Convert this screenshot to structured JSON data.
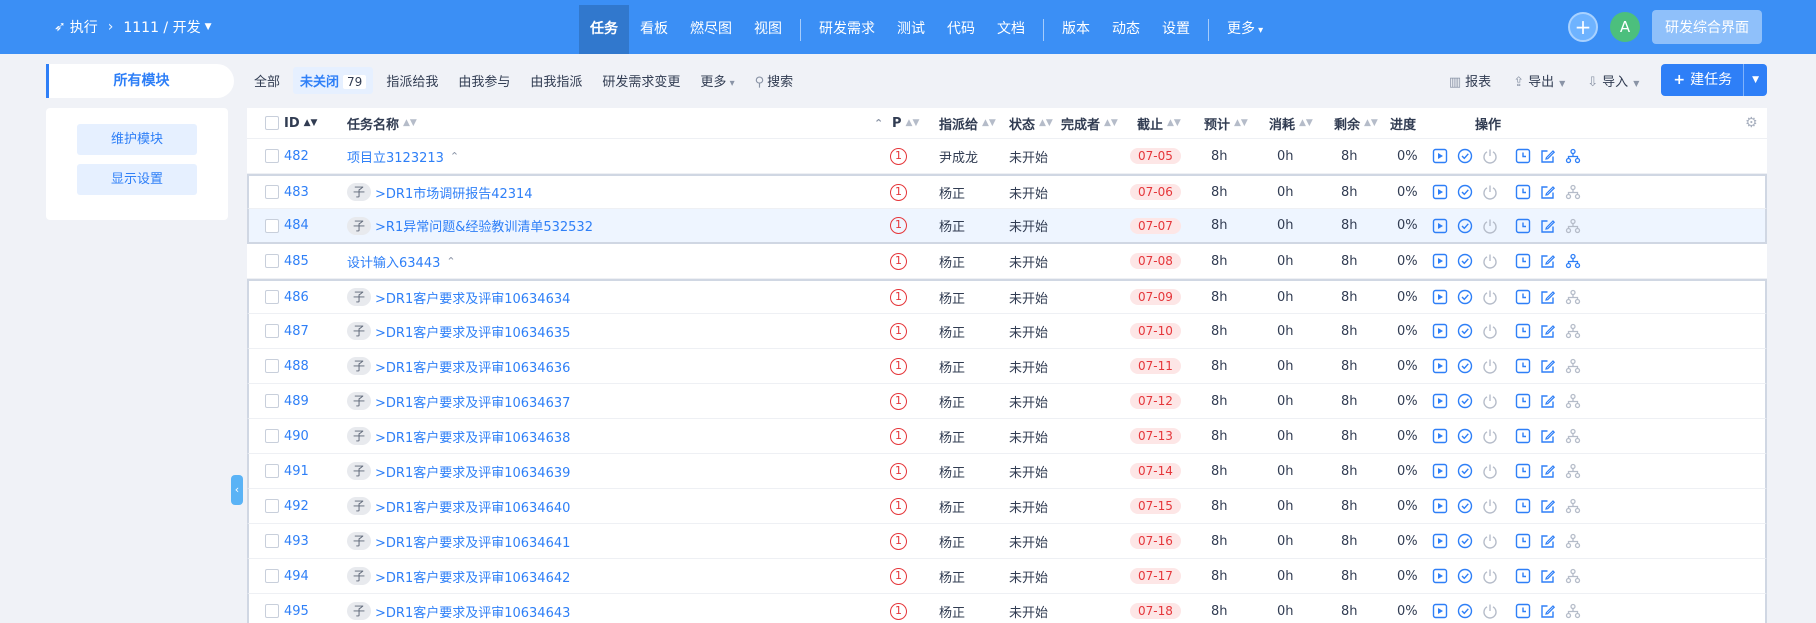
{
  "breadcrumb": {
    "app": "执行",
    "project": "1111 / 开发"
  },
  "nav": {
    "groups": [
      [
        "任务",
        "看板",
        "燃尽图",
        "视图"
      ],
      [
        "研发需求",
        "测试",
        "代码",
        "文档"
      ],
      [
        "版本",
        "动态",
        "设置"
      ],
      [
        "更多"
      ]
    ],
    "active": "任务"
  },
  "user": {
    "avatar": "A",
    "dev_button": "研发综合界面"
  },
  "sidebar": {
    "tab": "所有模块",
    "buttons": [
      "维护模块",
      "显示设置"
    ]
  },
  "toolbar": {
    "tabs": [
      {
        "label": "全部"
      },
      {
        "label": "未关闭",
        "count": "79",
        "active": true
      },
      {
        "label": "指派给我"
      },
      {
        "label": "由我参与"
      },
      {
        "label": "由我指派"
      },
      {
        "label": "研发需求变更"
      },
      {
        "label": "更多"
      }
    ],
    "search": "搜索",
    "report": "报表",
    "export": "导出",
    "import": "导入",
    "create": "建任务"
  },
  "table": {
    "headers": {
      "id": "ID",
      "name": "任务名称",
      "pri": "P",
      "assigned": "指派给",
      "status": "状态",
      "finisher": "完成者",
      "deadline": "截止",
      "estimate": "预计",
      "consumed": "消耗",
      "left": "剩余",
      "progress": "进度",
      "actions": "操作"
    },
    "rows": [
      {
        "id": "482",
        "name": "项目立3123213",
        "child": false,
        "pri": "1",
        "assigned": "尹成龙",
        "status": "未开始",
        "deadline": "07-05",
        "estimate": "8h",
        "consumed": "0h",
        "left": "8h",
        "progress": "0%"
      },
      {
        "id": "483",
        "name": ">DR1市场调研报告42314",
        "child": true,
        "pri": "1",
        "assigned": "杨正",
        "status": "未开始",
        "deadline": "07-06",
        "estimate": "8h",
        "consumed": "0h",
        "left": "8h",
        "progress": "0%"
      },
      {
        "id": "484",
        "name": ">R1异常问题&经验教训清单532532",
        "child": true,
        "pri": "1",
        "assigned": "杨正",
        "status": "未开始",
        "deadline": "07-07",
        "estimate": "8h",
        "consumed": "0h",
        "left": "8h",
        "progress": "0%"
      },
      {
        "id": "485",
        "name": "设计输入63443",
        "child": false,
        "pri": "1",
        "assigned": "杨正",
        "status": "未开始",
        "deadline": "07-08",
        "estimate": "8h",
        "consumed": "0h",
        "left": "8h",
        "progress": "0%"
      },
      {
        "id": "486",
        "name": ">DR1客户要求及评审10634634",
        "child": true,
        "pri": "1",
        "assigned": "杨正",
        "status": "未开始",
        "deadline": "07-09",
        "estimate": "8h",
        "consumed": "0h",
        "left": "8h",
        "progress": "0%"
      },
      {
        "id": "487",
        "name": ">DR1客户要求及评审10634635",
        "child": true,
        "pri": "1",
        "assigned": "杨正",
        "status": "未开始",
        "deadline": "07-10",
        "estimate": "8h",
        "consumed": "0h",
        "left": "8h",
        "progress": "0%"
      },
      {
        "id": "488",
        "name": ">DR1客户要求及评审10634636",
        "child": true,
        "pri": "1",
        "assigned": "杨正",
        "status": "未开始",
        "deadline": "07-11",
        "estimate": "8h",
        "consumed": "0h",
        "left": "8h",
        "progress": "0%"
      },
      {
        "id": "489",
        "name": ">DR1客户要求及评审10634637",
        "child": true,
        "pri": "1",
        "assigned": "杨正",
        "status": "未开始",
        "deadline": "07-12",
        "estimate": "8h",
        "consumed": "0h",
        "left": "8h",
        "progress": "0%"
      },
      {
        "id": "490",
        "name": ">DR1客户要求及评审10634638",
        "child": true,
        "pri": "1",
        "assigned": "杨正",
        "status": "未开始",
        "deadline": "07-13",
        "estimate": "8h",
        "consumed": "0h",
        "left": "8h",
        "progress": "0%"
      },
      {
        "id": "491",
        "name": ">DR1客户要求及评审10634639",
        "child": true,
        "pri": "1",
        "assigned": "杨正",
        "status": "未开始",
        "deadline": "07-14",
        "estimate": "8h",
        "consumed": "0h",
        "left": "8h",
        "progress": "0%"
      },
      {
        "id": "492",
        "name": ">DR1客户要求及评审10634640",
        "child": true,
        "pri": "1",
        "assigned": "杨正",
        "status": "未开始",
        "deadline": "07-15",
        "estimate": "8h",
        "consumed": "0h",
        "left": "8h",
        "progress": "0%"
      },
      {
        "id": "493",
        "name": ">DR1客户要求及评审10634641",
        "child": true,
        "pri": "1",
        "assigned": "杨正",
        "status": "未开始",
        "deadline": "07-16",
        "estimate": "8h",
        "consumed": "0h",
        "left": "8h",
        "progress": "0%"
      },
      {
        "id": "494",
        "name": ">DR1客户要求及评审10634642",
        "child": true,
        "pri": "1",
        "assigned": "杨正",
        "status": "未开始",
        "deadline": "07-17",
        "estimate": "8h",
        "consumed": "0h",
        "left": "8h",
        "progress": "0%"
      },
      {
        "id": "495",
        "name": ">DR1客户要求及评审10634643",
        "child": true,
        "pri": "1",
        "assigned": "杨正",
        "status": "未开始",
        "deadline": "07-18",
        "estimate": "8h",
        "consumed": "0h",
        "left": "8h",
        "progress": "0%"
      }
    ],
    "child_badge": "子",
    "highlighted_row": "484"
  },
  "colors": {
    "primary": "#3b8ff5",
    "accent": "#2e7ff7",
    "danger": "#e5363a"
  }
}
